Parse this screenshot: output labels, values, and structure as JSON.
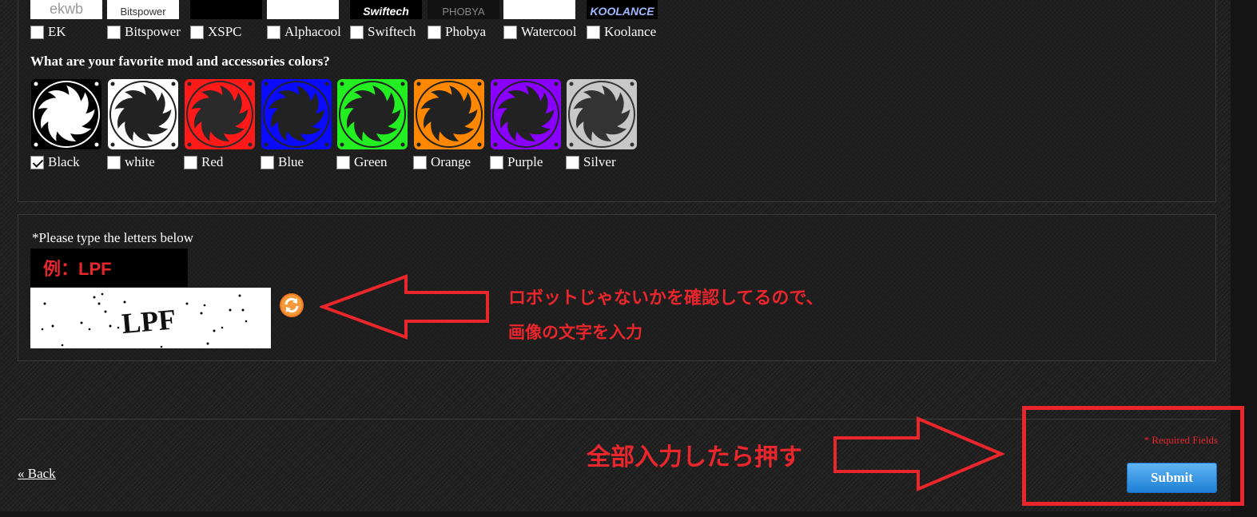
{
  "brands": [
    {
      "label": "EK",
      "logo_text": "ekwb",
      "logo_bg": "#ffffff",
      "logo_fg": "#9a9a9a"
    },
    {
      "label": "Bitspower",
      "logo_text": "Bitspower",
      "logo_bg": "#ffffff",
      "logo_fg": "#333333"
    },
    {
      "label": "XSPC",
      "logo_text": "",
      "logo_bg": "#000000",
      "logo_fg": "#ffffff"
    },
    {
      "label": "Alphacool",
      "logo_text": "",
      "logo_bg": "#ffffff",
      "logo_fg": "#333333"
    },
    {
      "label": "Swiftech",
      "logo_text": "Swiftech",
      "logo_bg": "#000000",
      "logo_fg": "#ffffff"
    },
    {
      "label": "Phobya",
      "logo_text": "PHOBYA",
      "logo_bg": "#111111",
      "logo_fg": "#888888"
    },
    {
      "label": "Watercool",
      "logo_text": "",
      "logo_bg": "#ffffff",
      "logo_fg": "#333333"
    },
    {
      "label": "Koolance",
      "logo_text": "KOOLANCE",
      "logo_bg": "#000000",
      "logo_fg": "#9fb8ff"
    }
  ],
  "colors_question": "What are your favorite mod and accessories colors?",
  "colors": [
    {
      "label": "Black",
      "fan_color": "#000000",
      "blade_color": "#ffffff",
      "checked": true
    },
    {
      "label": "white",
      "fan_color": "#ffffff",
      "blade_color": "#222222",
      "checked": false
    },
    {
      "label": "Red",
      "fan_color": "#ff1a1a",
      "blade_color": "#2a2a2a",
      "checked": false
    },
    {
      "label": "Blue",
      "fan_color": "#0a0aff",
      "blade_color": "#222222",
      "checked": false
    },
    {
      "label": "Green",
      "fan_color": "#22ee22",
      "blade_color": "#222222",
      "checked": false
    },
    {
      "label": "Orange",
      "fan_color": "#ff8800",
      "blade_color": "#222222",
      "checked": false
    },
    {
      "label": "Purple",
      "fan_color": "#8a00ff",
      "blade_color": "#222222",
      "checked": false
    },
    {
      "label": "Silver",
      "fan_color": "#c8c8c8",
      "blade_color": "#333333",
      "checked": false
    }
  ],
  "captcha": {
    "label": "*Please type the letters below",
    "example": "例：LPF",
    "image_text": "LPF",
    "refresh_icon": "refresh-icon"
  },
  "annotations": {
    "captcha_note_line1": "ロボットじゃないかを確認してるので、",
    "captcha_note_line2": "画像の文字を入力",
    "submit_note": "全部入力したら押す",
    "color": "#e8262c"
  },
  "footer": {
    "back_label": "« Back",
    "required_star": "*",
    "required_text": "Required Fields",
    "submit_label": "Submit"
  }
}
